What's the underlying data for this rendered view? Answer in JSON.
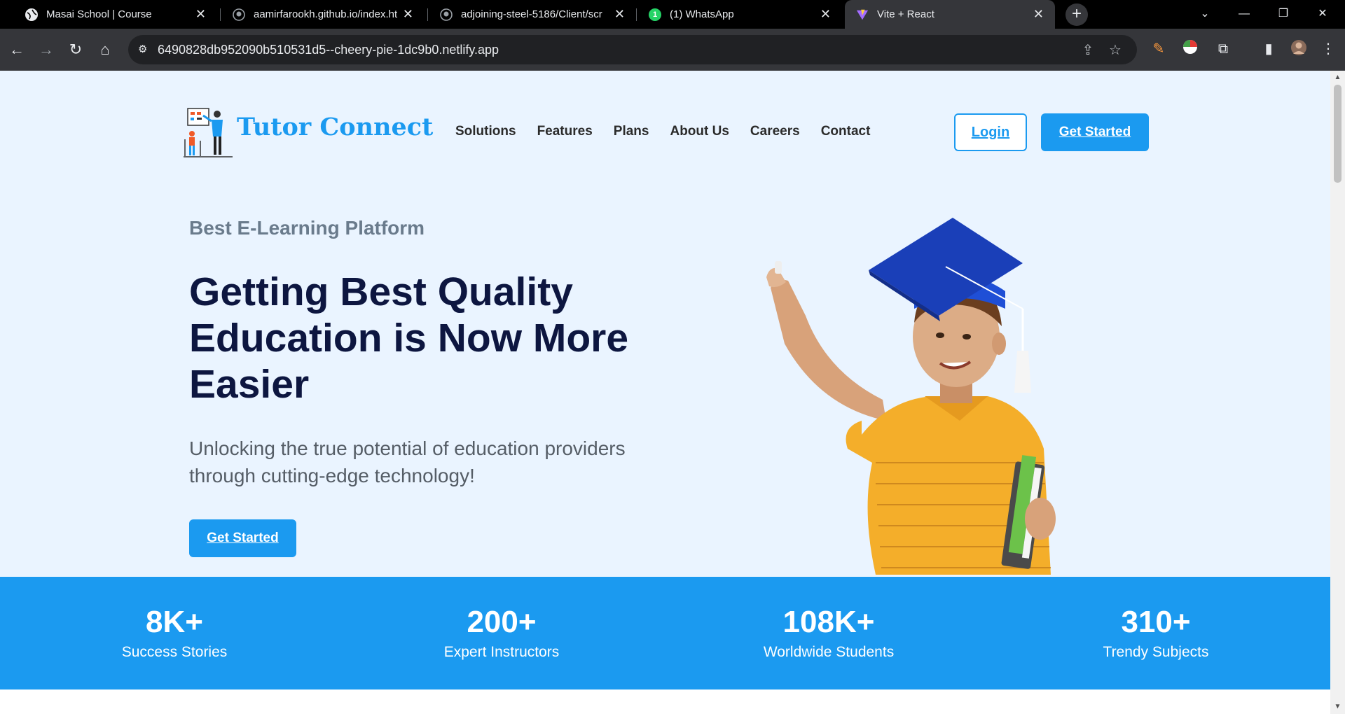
{
  "browser": {
    "tabs": [
      {
        "title": "Masai School | Course",
        "favicon": "globe-icon"
      },
      {
        "title": "aamirfarookh.github.io/index.ht",
        "favicon": "github-icon"
      },
      {
        "title": "adjoining-steel-5186/Client/scr",
        "favicon": "github-icon"
      },
      {
        "title": "(1) WhatsApp",
        "favicon": "whatsapp-icon"
      },
      {
        "title": "Vite + React",
        "favicon": "vite-icon"
      }
    ],
    "url": "6490828db952090b510531d5--cheery-pie-1dc9b0.netlify.app"
  },
  "site": {
    "brand": "Tutor Connect",
    "nav": [
      "Solutions",
      "Features",
      "Plans",
      "About Us",
      "Careers",
      "Contact"
    ],
    "login_label": "Login",
    "get_started_label": "Get Started"
  },
  "hero": {
    "eyebrow": "Best E-Learning Platform",
    "headline": "Getting Best Quality Education is Now More Easier",
    "subtext": "Unlocking the true potential of education providers through cutting-edge technology!",
    "cta_label": "Get Started"
  },
  "stats": [
    {
      "value": "8K+",
      "label": "Success Stories"
    },
    {
      "value": "200+",
      "label": "Expert Instructors"
    },
    {
      "value": "108K+",
      "label": "Worldwide Students"
    },
    {
      "value": "310+",
      "label": "Trendy Subjects"
    }
  ],
  "colors": {
    "accent": "#1b9af0",
    "hero_bg": "#eaf4ff",
    "headline": "#0d1640"
  }
}
